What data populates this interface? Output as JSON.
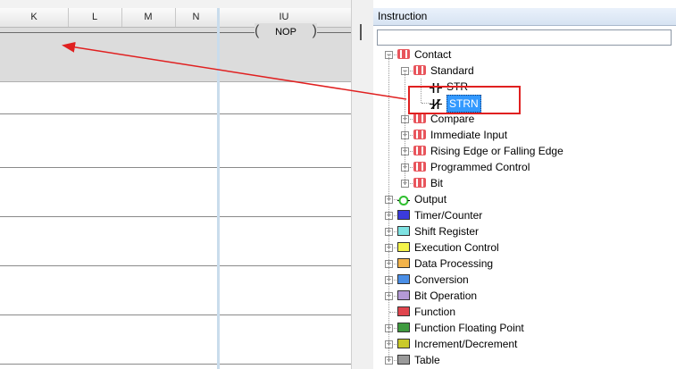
{
  "ladder": {
    "columns": [
      {
        "label": "K",
        "w": 76
      },
      {
        "label": "L",
        "w": 60
      },
      {
        "label": "M",
        "w": 60
      },
      {
        "label": "N",
        "w": 47
      },
      {
        "label": "IU",
        "w": 150
      }
    ],
    "nop_label": "NOP"
  },
  "pane": {
    "title": "Instruction",
    "search_value": ""
  },
  "tree": [
    {
      "label": "Contact",
      "level": 0,
      "icon": "contact-icon",
      "color": "#e8555c",
      "expanded": true
    },
    {
      "label": "Standard",
      "level": 1,
      "icon": "contact-icon",
      "color": "#e8555c",
      "expanded": true
    },
    {
      "label": "STR",
      "level": 2,
      "icon": "normally-open-contact-icon",
      "color": "#000000"
    },
    {
      "label": "STRN",
      "level": 2,
      "icon": "normally-closed-contact-icon",
      "color": "#000000",
      "selected": true
    },
    {
      "label": "Compare",
      "level": 1,
      "icon": "contact-icon",
      "color": "#e8555c",
      "expanded": false
    },
    {
      "label": "Immediate Input",
      "level": 1,
      "icon": "contact-icon",
      "color": "#e8555c",
      "expanded": false
    },
    {
      "label": "Rising Edge or Falling Edge",
      "level": 1,
      "icon": "contact-icon",
      "color": "#e8555c",
      "expanded": false
    },
    {
      "label": "Programmed Control",
      "level": 1,
      "icon": "contact-icon",
      "color": "#e8555c",
      "expanded": false
    },
    {
      "label": "Bit",
      "level": 1,
      "icon": "contact-icon",
      "color": "#e8555c",
      "expanded": false
    },
    {
      "label": "Output",
      "level": 0,
      "icon": "output-coil-icon",
      "color": "#2fbf2f",
      "expanded": false
    },
    {
      "label": "Timer/Counter",
      "level": 0,
      "icon": "timer-counter-icon",
      "color": "#3b3bdc",
      "expanded": false
    },
    {
      "label": "Shift Register",
      "level": 0,
      "icon": "shift-register-icon",
      "color": "#7fe3e3",
      "expanded": false
    },
    {
      "label": "Execution Control",
      "level": 0,
      "icon": "execution-control-icon",
      "color": "#f4f44a",
      "expanded": false
    },
    {
      "label": "Data Processing",
      "level": 0,
      "icon": "data-processing-icon",
      "color": "#f2b34a",
      "expanded": false
    },
    {
      "label": "Conversion",
      "level": 0,
      "icon": "conversion-icon",
      "color": "#4a8ee6",
      "expanded": false
    },
    {
      "label": "Bit Operation",
      "level": 0,
      "icon": "bit-operation-icon",
      "color": "#b49ad6",
      "expanded": false
    },
    {
      "label": "Function",
      "level": 0,
      "icon": "function-icon",
      "color": "#e0454e",
      "expanded": null
    },
    {
      "label": "Function Floating Point",
      "level": 0,
      "icon": "function-floating-point-icon",
      "color": "#3f9a3f",
      "expanded": false
    },
    {
      "label": "Increment/Decrement",
      "level": 0,
      "icon": "increment-decrement-icon",
      "color": "#c9c92a",
      "expanded": false
    },
    {
      "label": "Table",
      "level": 0,
      "icon": "table-icon",
      "color": "#9a9a9a",
      "expanded": false
    }
  ]
}
